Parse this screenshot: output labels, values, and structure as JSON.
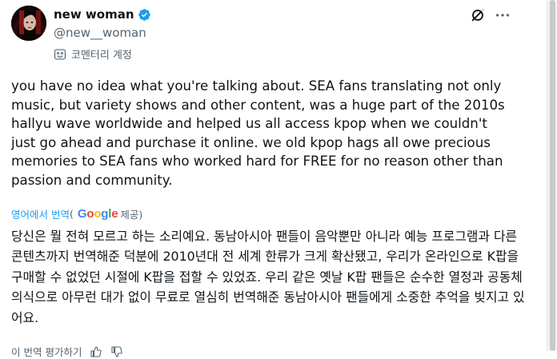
{
  "author": {
    "display_name": "new woman",
    "handle": "@new__woman",
    "account_type": "코멘터리 계정",
    "avatar_icon": "avatar-image",
    "verified_color": "#1d9bf0"
  },
  "post": {
    "text": "you have no idea what you're talking about. SEA fans translating not only music, but variety shows and other content, was a huge part of the 2010s hallyu wave worldwide and helped us all access kpop when we couldn't just go ahead and purchase it online. we old kpop hags all owe precious memories to SEA fans who worked hard for FREE for no reason other than passion and community."
  },
  "translation": {
    "link_label": "영어에서 번역",
    "open_paren": "(",
    "provider_g1": "G",
    "provider_o1": "o",
    "provider_o2": "o",
    "provider_g2": "g",
    "provider_l": "l",
    "provider_e": "e",
    "provided_label": " 제공)",
    "text": "당신은 뭘 전혀 모르고 하는 소리예요. 동남아시아 팬들이 음악뿐만 아니라 예능 프로그램과 다른 콘텐츠까지 번역해준 덕분에 2010년대 전 세계 한류가 크게 확산됐고, 우리가 온라인으로 K팝을 구매할 수 없었던 시절에 K팝을 접할 수 있었죠. 우리 같은 옛날 K팝 팬들은 순수한 열정과 공동체 의식으로 아무런 대가 없이 무료로 열심히 번역해준 동남아시아 팬들에게 소중한 추억을 빚지고 있어요."
  },
  "footer": {
    "label": "이 번역 평가하기"
  },
  "icons": {
    "grok": "grok-icon",
    "more": "more-icon",
    "mask": "mask-icon",
    "thumbs_up": "thumbs-up-icon",
    "thumbs_down": "thumbs-down-icon"
  },
  "colors": {
    "text_primary": "#0f1419",
    "text_secondary": "#536471",
    "link": "#1d9bf0"
  }
}
